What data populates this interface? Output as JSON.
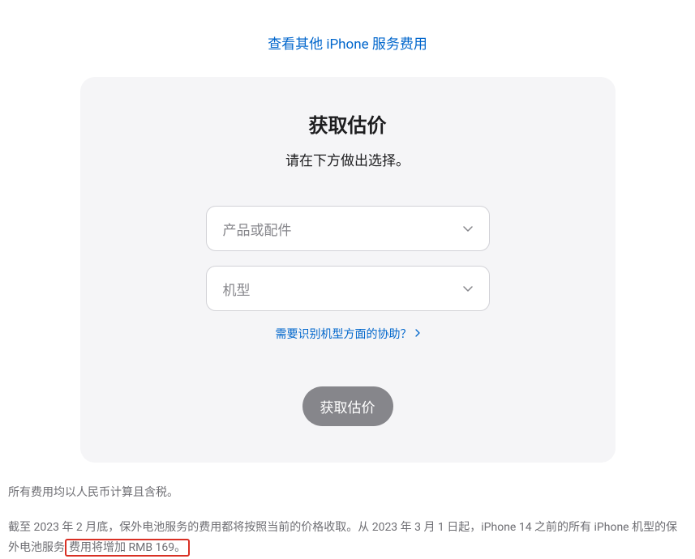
{
  "topLink": {
    "label": "查看其他 iPhone 服务费用"
  },
  "card": {
    "title": "获取估价",
    "subtitle": "请在下方做出选择。",
    "select1": {
      "placeholder": "产品或配件"
    },
    "select2": {
      "placeholder": "机型"
    },
    "helpLink": {
      "label": "需要识别机型方面的协助？"
    },
    "submitButton": {
      "label": "获取估价"
    }
  },
  "footer": {
    "line1": "所有费用均以人民币计算且含税。",
    "line2a": "截至 2023 年 2 月底，保外电池服务的费用都将按照当前的价格收取。从 2023 年 3 月 1 日起，iPhone 14 之前的所有 iPhone 机型的保外电池服务",
    "line2b": "费用将增加 RMB 169。"
  }
}
